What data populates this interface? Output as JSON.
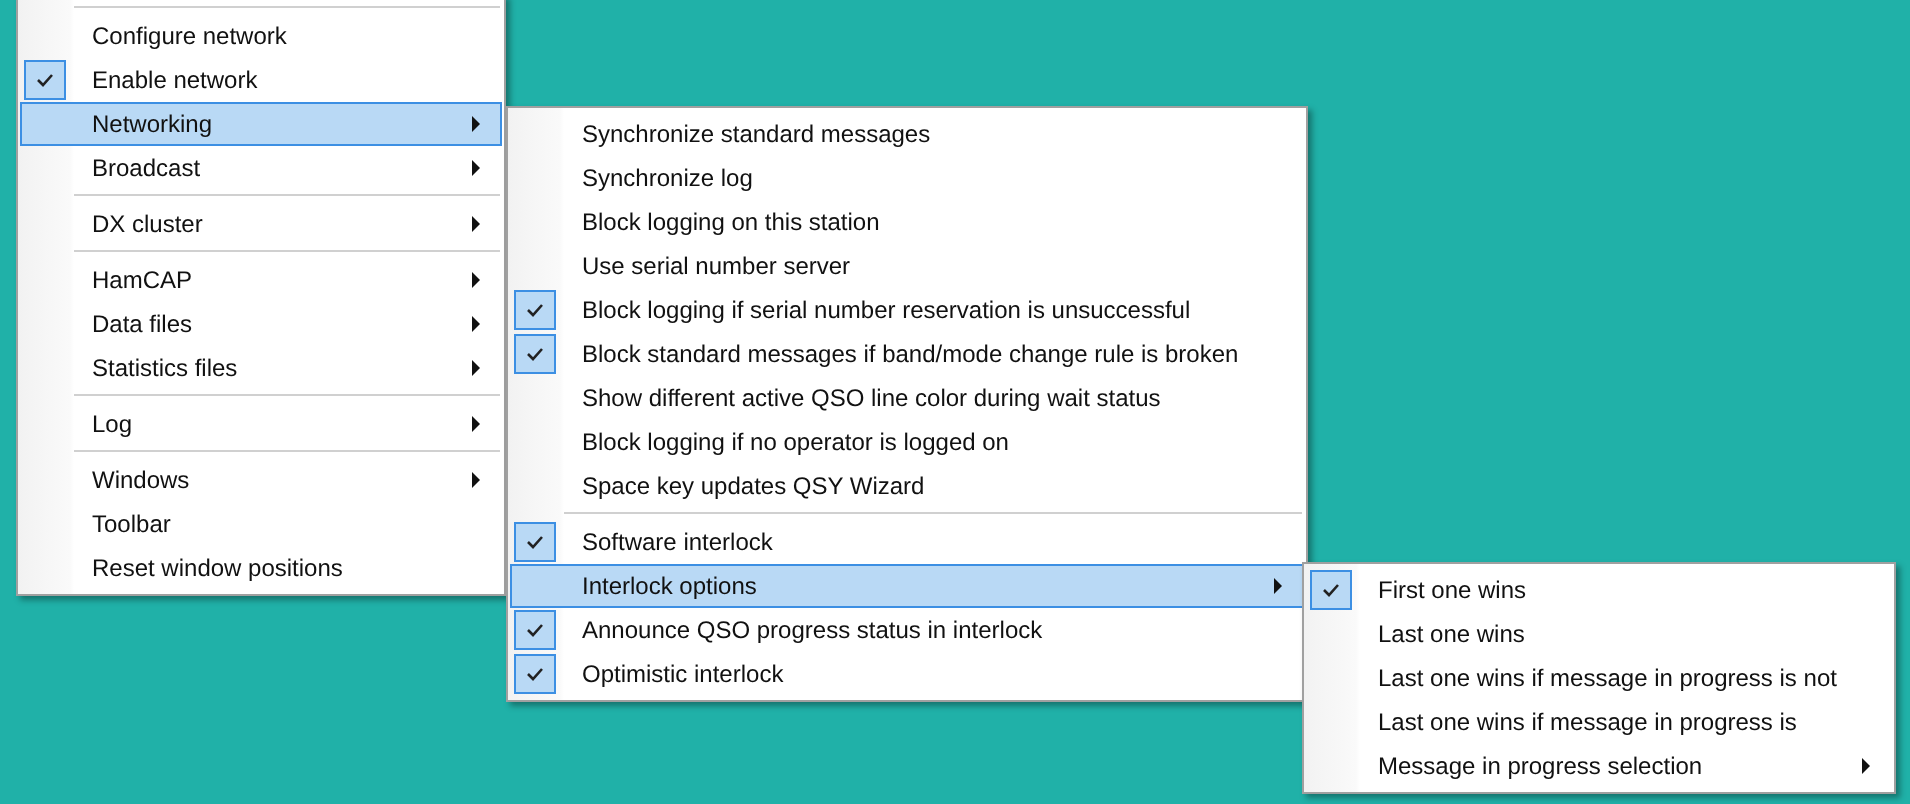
{
  "menus": [
    {
      "items": [
        {
          "kind": "separator"
        },
        {
          "kind": "item",
          "label": "Configure network",
          "checked": false,
          "submenu": false,
          "selected": false
        },
        {
          "kind": "item",
          "label": "Enable network",
          "checked": true,
          "submenu": false,
          "selected": false
        },
        {
          "kind": "item",
          "label": "Networking",
          "checked": false,
          "submenu": true,
          "selected": true
        },
        {
          "kind": "item",
          "label": "Broadcast",
          "checked": false,
          "submenu": true,
          "selected": false
        },
        {
          "kind": "separator"
        },
        {
          "kind": "item",
          "label": "DX cluster",
          "checked": false,
          "submenu": true,
          "selected": false
        },
        {
          "kind": "separator"
        },
        {
          "kind": "item",
          "label": "HamCAP",
          "checked": false,
          "submenu": true,
          "selected": false
        },
        {
          "kind": "item",
          "label": "Data files",
          "checked": false,
          "submenu": true,
          "selected": false
        },
        {
          "kind": "item",
          "label": "Statistics files",
          "checked": false,
          "submenu": true,
          "selected": false
        },
        {
          "kind": "separator"
        },
        {
          "kind": "item",
          "label": "Log",
          "checked": false,
          "submenu": true,
          "selected": false
        },
        {
          "kind": "separator"
        },
        {
          "kind": "item",
          "label": "Windows",
          "checked": false,
          "submenu": true,
          "selected": false
        },
        {
          "kind": "item",
          "label": "Toolbar",
          "checked": false,
          "submenu": false,
          "selected": false
        },
        {
          "kind": "item",
          "label": "Reset window positions",
          "checked": false,
          "submenu": false,
          "selected": false
        }
      ]
    },
    {
      "items": [
        {
          "kind": "item",
          "label": "Synchronize standard messages",
          "checked": false,
          "submenu": false,
          "selected": false
        },
        {
          "kind": "item",
          "label": "Synchronize log",
          "checked": false,
          "submenu": false,
          "selected": false
        },
        {
          "kind": "item",
          "label": "Block logging on this station",
          "checked": false,
          "submenu": false,
          "selected": false
        },
        {
          "kind": "item",
          "label": "Use serial number server",
          "checked": false,
          "submenu": false,
          "selected": false
        },
        {
          "kind": "item",
          "label": "Block logging if serial number reservation is unsuccessful",
          "checked": true,
          "submenu": false,
          "selected": false
        },
        {
          "kind": "item",
          "label": "Block standard messages if band/mode change rule is broken",
          "checked": true,
          "submenu": false,
          "selected": false
        },
        {
          "kind": "item",
          "label": "Show different active QSO line color during wait status",
          "checked": false,
          "submenu": false,
          "selected": false
        },
        {
          "kind": "item",
          "label": "Block logging if no operator is logged on",
          "checked": false,
          "submenu": false,
          "selected": false
        },
        {
          "kind": "item",
          "label": "Space key updates QSY Wizard",
          "checked": false,
          "submenu": false,
          "selected": false
        },
        {
          "kind": "separator"
        },
        {
          "kind": "item",
          "label": "Software interlock",
          "checked": true,
          "submenu": false,
          "selected": false
        },
        {
          "kind": "item",
          "label": "Interlock options",
          "checked": false,
          "submenu": true,
          "selected": true
        },
        {
          "kind": "item",
          "label": "Announce QSO progress status in interlock",
          "checked": true,
          "submenu": false,
          "selected": false
        },
        {
          "kind": "item",
          "label": "Optimistic interlock",
          "checked": true,
          "submenu": false,
          "selected": false
        }
      ]
    },
    {
      "items": [
        {
          "kind": "item",
          "label": "First one wins",
          "checked": true,
          "submenu": false,
          "selected": false
        },
        {
          "kind": "item",
          "label": "Last one wins",
          "checked": false,
          "submenu": false,
          "selected": false
        },
        {
          "kind": "item",
          "label": "Last one wins if message in progress is not",
          "checked": false,
          "submenu": false,
          "selected": false
        },
        {
          "kind": "item",
          "label": "Last one wins if message in progress is",
          "checked": false,
          "submenu": false,
          "selected": false
        },
        {
          "kind": "item",
          "label": "Message in progress selection",
          "checked": false,
          "submenu": true,
          "selected": false
        }
      ]
    }
  ]
}
